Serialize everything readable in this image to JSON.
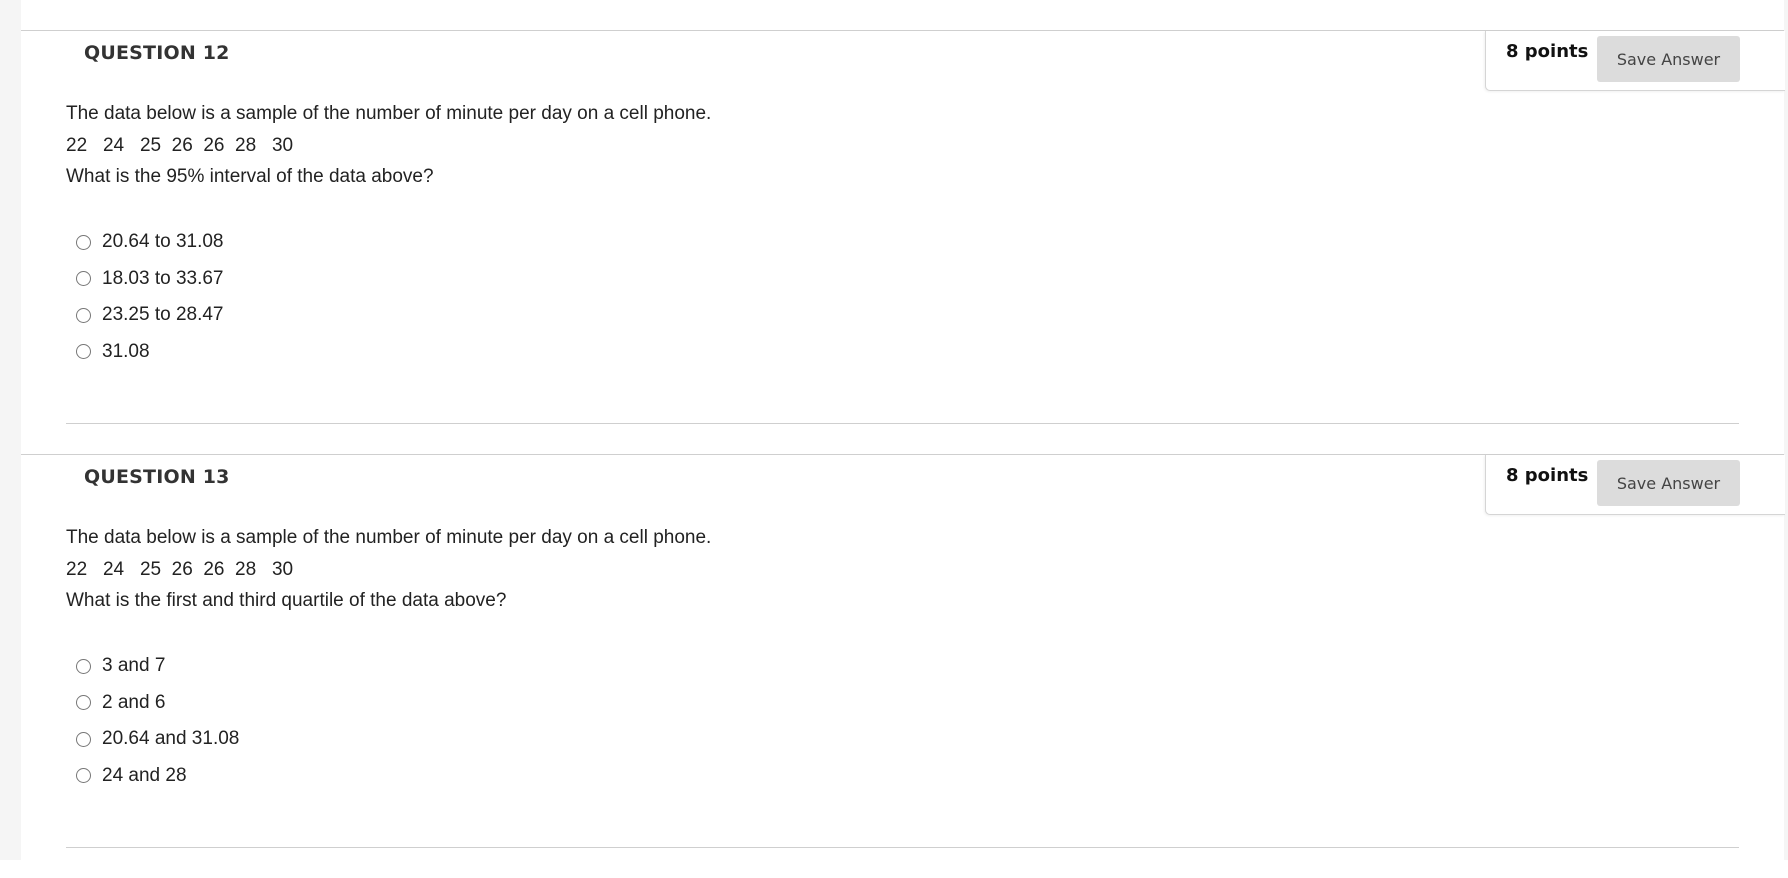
{
  "questions": [
    {
      "title": "QUESTION 12",
      "points": "8 points",
      "save_label": "Save Answer",
      "prompt": "The data below is a sample of the number of minute per day on a cell phone.",
      "data_line": "22   24   25  26  26  28   30",
      "question": "What is the 95% interval of the data above?",
      "options": [
        "20.64 to 31.08",
        "18.03 to 33.67",
        "23.25 to 28.47",
        "31.08"
      ]
    },
    {
      "title": "QUESTION 13",
      "points": "8 points",
      "save_label": "Save Answer",
      "prompt": "The data below is a sample of the number of minute per day on a cell phone.",
      "data_line": "22   24   25  26  26  28   30",
      "question": "What is the first and third quartile of the data above?",
      "options": [
        "3 and 7",
        "2 and 6",
        "20.64 and 31.08",
        "24 and 28"
      ]
    }
  ]
}
